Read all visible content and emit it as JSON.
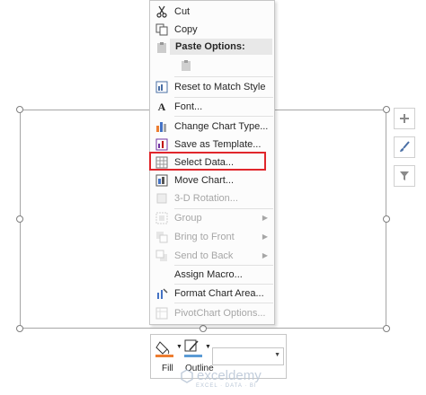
{
  "context_menu": {
    "items": [
      {
        "label": "Cut",
        "icon": "scissors-icon",
        "enabled": true
      },
      {
        "label": "Copy",
        "icon": "copy-icon",
        "enabled": true
      },
      {
        "label": "Paste Options:",
        "icon": "paste-icon",
        "enabled": false,
        "header": true
      },
      {
        "label": "Reset to Match Style",
        "icon": "reset-style-icon",
        "enabled": true
      },
      {
        "label": "Font...",
        "icon": "font-icon",
        "enabled": true
      },
      {
        "label": "Change Chart Type...",
        "icon": "chart-type-icon",
        "enabled": true
      },
      {
        "label": "Save as Template...",
        "icon": "template-icon",
        "enabled": true
      },
      {
        "label": "Select Data...",
        "icon": "select-data-icon",
        "enabled": true,
        "highlighted": true
      },
      {
        "label": "Move Chart...",
        "icon": "move-chart-icon",
        "enabled": true
      },
      {
        "label": "3-D Rotation...",
        "icon": "rotation-icon",
        "enabled": false
      },
      {
        "label": "Group",
        "icon": "group-icon",
        "enabled": false,
        "submenu": true
      },
      {
        "label": "Bring to Front",
        "icon": "bring-front-icon",
        "enabled": false,
        "submenu": true
      },
      {
        "label": "Send to Back",
        "icon": "send-back-icon",
        "enabled": false,
        "submenu": true
      },
      {
        "label": "Assign Macro...",
        "icon": "",
        "enabled": true
      },
      {
        "label": "Format Chart Area...",
        "icon": "format-area-icon",
        "enabled": true
      },
      {
        "label": "PivotChart Options...",
        "icon": "pivot-icon",
        "enabled": false
      }
    ]
  },
  "mini_toolbar": {
    "fill_label": "Fill",
    "outline_label": "Outline",
    "fill_color": "#ed7d31",
    "outline_color": "#5b9bd5"
  },
  "watermark": {
    "name": "exceldemy",
    "sub": "EXCEL · DATA · BI"
  },
  "colors": {
    "highlight": "#e0262b"
  }
}
